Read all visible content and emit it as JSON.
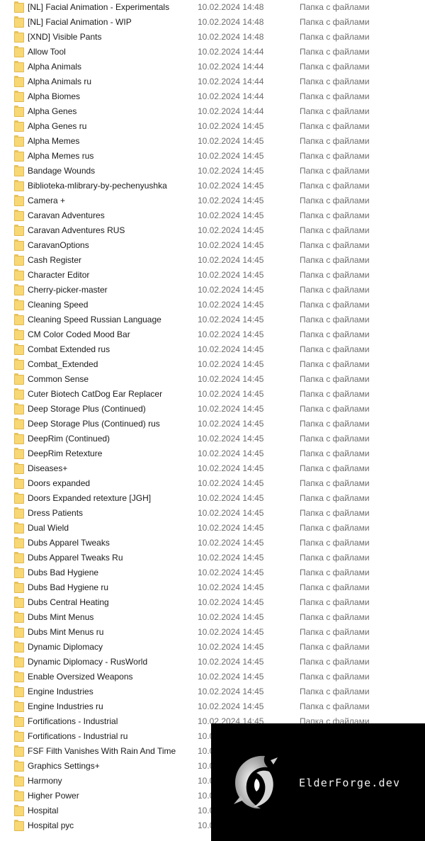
{
  "folders": [
    {
      "name": "[NL] Facial Animation - Experimentals",
      "date": "10.02.2024 14:48",
      "type": "Папка с файлами"
    },
    {
      "name": "[NL] Facial Animation - WIP",
      "date": "10.02.2024 14:48",
      "type": "Папка с файлами"
    },
    {
      "name": "[XND] Visible Pants",
      "date": "10.02.2024 14:48",
      "type": "Папка с файлами"
    },
    {
      "name": "Allow Tool",
      "date": "10.02.2024 14:44",
      "type": "Папка с файлами"
    },
    {
      "name": "Alpha Animals",
      "date": "10.02.2024 14:44",
      "type": "Папка с файлами"
    },
    {
      "name": "Alpha Animals ru",
      "date": "10.02.2024 14:44",
      "type": "Папка с файлами"
    },
    {
      "name": "Alpha Biomes",
      "date": "10.02.2024 14:44",
      "type": "Папка с файлами"
    },
    {
      "name": "Alpha Genes",
      "date": "10.02.2024 14:44",
      "type": "Папка с файлами"
    },
    {
      "name": "Alpha Genes ru",
      "date": "10.02.2024 14:45",
      "type": "Папка с файлами"
    },
    {
      "name": "Alpha Memes",
      "date": "10.02.2024 14:45",
      "type": "Папка с файлами"
    },
    {
      "name": "Alpha Memes rus",
      "date": "10.02.2024 14:45",
      "type": "Папка с файлами"
    },
    {
      "name": "Bandage Wounds",
      "date": "10.02.2024 14:45",
      "type": "Папка с файлами"
    },
    {
      "name": "Biblioteka-mlibrary-by-pechenyushka",
      "date": "10.02.2024 14:45",
      "type": "Папка с файлами"
    },
    {
      "name": "Camera +",
      "date": "10.02.2024 14:45",
      "type": "Папка с файлами"
    },
    {
      "name": "Caravan Adventures",
      "date": "10.02.2024 14:45",
      "type": "Папка с файлами"
    },
    {
      "name": "Caravan Adventures RUS",
      "date": "10.02.2024 14:45",
      "type": "Папка с файлами"
    },
    {
      "name": "CaravanOptions",
      "date": "10.02.2024 14:45",
      "type": "Папка с файлами"
    },
    {
      "name": "Cash Register",
      "date": "10.02.2024 14:45",
      "type": "Папка с файлами"
    },
    {
      "name": "Character Editor",
      "date": "10.02.2024 14:45",
      "type": "Папка с файлами"
    },
    {
      "name": "Cherry-picker-master",
      "date": "10.02.2024 14:45",
      "type": "Папка с файлами"
    },
    {
      "name": "Cleaning Speed",
      "date": "10.02.2024 14:45",
      "type": "Папка с файлами"
    },
    {
      "name": "Cleaning Speed Russian Language",
      "date": "10.02.2024 14:45",
      "type": "Папка с файлами"
    },
    {
      "name": "CM Color Coded Mood Bar",
      "date": "10.02.2024 14:45",
      "type": "Папка с файлами"
    },
    {
      "name": "Combat Extended rus",
      "date": "10.02.2024 14:45",
      "type": "Папка с файлами"
    },
    {
      "name": "Combat_Extended",
      "date": "10.02.2024 14:45",
      "type": "Папка с файлами"
    },
    {
      "name": "Common Sense",
      "date": "10.02.2024 14:45",
      "type": "Папка с файлами"
    },
    {
      "name": "Cuter Biotech CatDog Ear Replacer",
      "date": "10.02.2024 14:45",
      "type": "Папка с файлами"
    },
    {
      "name": "Deep Storage Plus (Continued)",
      "date": "10.02.2024 14:45",
      "type": "Папка с файлами"
    },
    {
      "name": "Deep Storage Plus (Continued) rus",
      "date": "10.02.2024 14:45",
      "type": "Папка с файлами"
    },
    {
      "name": "DeepRim (Continued)",
      "date": "10.02.2024 14:45",
      "type": "Папка с файлами"
    },
    {
      "name": "DeepRim Retexture",
      "date": "10.02.2024 14:45",
      "type": "Папка с файлами"
    },
    {
      "name": "Diseases+",
      "date": "10.02.2024 14:45",
      "type": "Папка с файлами"
    },
    {
      "name": "Doors expanded",
      "date": "10.02.2024 14:45",
      "type": "Папка с файлами"
    },
    {
      "name": "Doors Expanded retexture [JGH]",
      "date": "10.02.2024 14:45",
      "type": "Папка с файлами"
    },
    {
      "name": "Dress Patients",
      "date": "10.02.2024 14:45",
      "type": "Папка с файлами"
    },
    {
      "name": "Dual Wield",
      "date": "10.02.2024 14:45",
      "type": "Папка с файлами"
    },
    {
      "name": "Dubs Apparel Tweaks",
      "date": "10.02.2024 14:45",
      "type": "Папка с файлами"
    },
    {
      "name": "Dubs Apparel Tweaks Ru",
      "date": "10.02.2024 14:45",
      "type": "Папка с файлами"
    },
    {
      "name": "Dubs Bad Hygiene",
      "date": "10.02.2024 14:45",
      "type": "Папка с файлами"
    },
    {
      "name": "Dubs Bad Hygiene ru",
      "date": "10.02.2024 14:45",
      "type": "Папка с файлами"
    },
    {
      "name": "Dubs Central Heating",
      "date": "10.02.2024 14:45",
      "type": "Папка с файлами"
    },
    {
      "name": "Dubs Mint Menus",
      "date": "10.02.2024 14:45",
      "type": "Папка с файлами"
    },
    {
      "name": "Dubs Mint Menus ru",
      "date": "10.02.2024 14:45",
      "type": "Папка с файлами"
    },
    {
      "name": "Dynamic Diplomacy",
      "date": "10.02.2024 14:45",
      "type": "Папка с файлами"
    },
    {
      "name": "Dynamic Diplomacy - RusWorld",
      "date": "10.02.2024 14:45",
      "type": "Папка с файлами"
    },
    {
      "name": "Enable Oversized Weapons",
      "date": "10.02.2024 14:45",
      "type": "Папка с файлами"
    },
    {
      "name": "Engine Industries",
      "date": "10.02.2024 14:45",
      "type": "Папка с файлами"
    },
    {
      "name": "Engine Industries ru",
      "date": "10.02.2024 14:45",
      "type": "Папка с файлами"
    },
    {
      "name": "Fortifications - Industrial",
      "date": "10.02.2024 14:45",
      "type": "Папка с файлами"
    },
    {
      "name": "Fortifications - Industrial ru",
      "date": "10.0",
      "type": ""
    },
    {
      "name": "FSF Filth Vanishes With Rain And Time",
      "date": "10.0",
      "type": ""
    },
    {
      "name": "Graphics Settings+",
      "date": "10.0",
      "type": ""
    },
    {
      "name": "Harmony",
      "date": "10.0",
      "type": ""
    },
    {
      "name": "Higher Power",
      "date": "10.0",
      "type": ""
    },
    {
      "name": "Hospital",
      "date": "10.0",
      "type": ""
    },
    {
      "name": "Hospital рус",
      "date": "10.0",
      "type": ""
    }
  ],
  "watermark": {
    "text": "ElderForge.dev",
    "logo_icon": "dragon-logo-icon"
  },
  "colors": {
    "folder_fill": "#f8d775",
    "folder_border": "#e0b94e",
    "text_primary": "#1a1a1a",
    "text_secondary": "#6d6d6d",
    "watermark_bg": "#000000"
  }
}
